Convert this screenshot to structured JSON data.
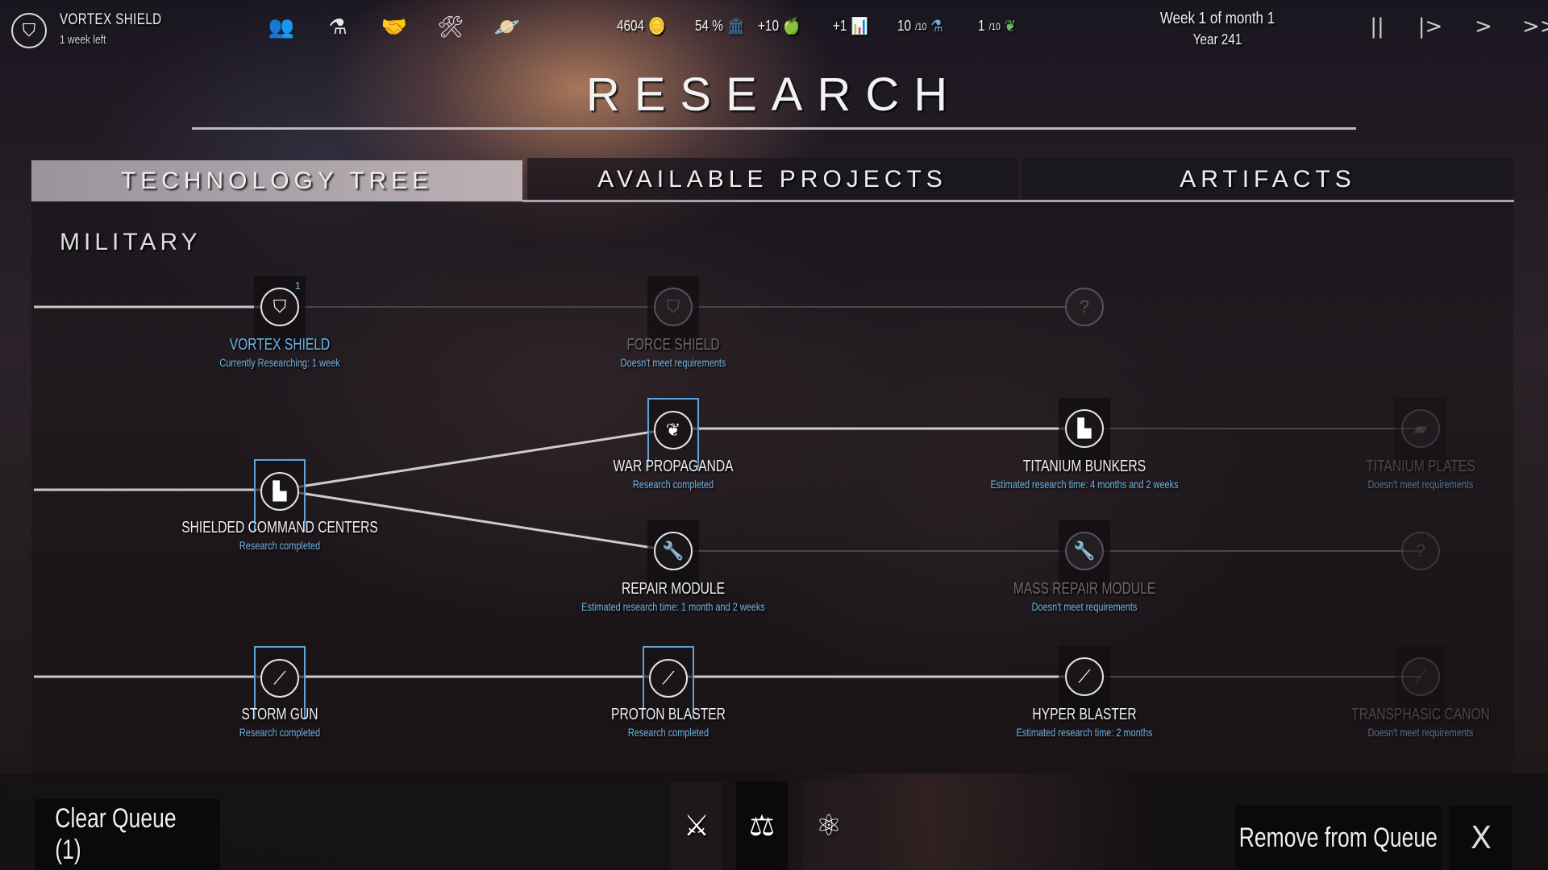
{
  "topbar": {
    "current_research": {
      "title": "VORTEX SHIELD",
      "subtitle": "1 week left",
      "icon": "shield-icon"
    },
    "nav_icons": [
      {
        "name": "population-icon",
        "glyph": "👥"
      },
      {
        "name": "research-flask-icon",
        "glyph": "⚗"
      },
      {
        "name": "diplomacy-handshake-icon",
        "glyph": "🤝"
      },
      {
        "name": "construction-tools-icon",
        "glyph": "🛠"
      },
      {
        "name": "planet-icon",
        "glyph": "🪐"
      }
    ],
    "resources": [
      {
        "name": "credits",
        "value": "4604",
        "icon": "coins-icon",
        "glyph": "🪙",
        "color": "#d9cf6a"
      },
      {
        "name": "approval",
        "value": "54 %",
        "icon": "government-building-icon",
        "glyph": "🏛",
        "color": "#4a86b8"
      },
      {
        "name": "food",
        "value": "+10",
        "icon": "apple-icon",
        "glyph": "🍏",
        "color": "#5e9a6a"
      },
      {
        "name": "industry",
        "value": "+1",
        "icon": "growth-chart-icon",
        "glyph": "📊",
        "color": "#9a66c4"
      },
      {
        "name": "research",
        "value": "10",
        "max": "/10",
        "icon": "flask-icon",
        "glyph": "⚗",
        "color": "#6aaee0"
      },
      {
        "name": "influence",
        "value": "1",
        "max": "/10",
        "icon": "laurel-icon",
        "glyph": "❦",
        "color": "#6bbf6b"
      }
    ],
    "date": {
      "line1": "Week 1 of month 1",
      "line2": "Year 241"
    },
    "speed_controls": [
      {
        "name": "pause-button",
        "glyph": "||"
      },
      {
        "name": "step-button",
        "glyph": "|>"
      },
      {
        "name": "play-button",
        "glyph": ">"
      },
      {
        "name": "fast-forward-button",
        "glyph": ">>"
      }
    ]
  },
  "title": "RESEARCH",
  "tabs": [
    {
      "label": "TECHNOLOGY TREE",
      "active": true
    },
    {
      "label": "AVAILABLE PROJECTS",
      "active": false
    },
    {
      "label": "ARTIFACTS",
      "active": false
    }
  ],
  "section": "MILITARY",
  "nodes": [
    {
      "id": "vortex",
      "name": "VORTEX SHIELD",
      "status": "Currently Researching: 1 week",
      "state": "active",
      "icon": "shield-icon",
      "glyph": "⛉",
      "badge": "1"
    },
    {
      "id": "force",
      "name": "FORCE SHIELD",
      "status": "Doesn't meet requirements",
      "state": "locked",
      "icon": "shield-icon",
      "glyph": "⛉"
    },
    {
      "id": "unknown1",
      "name": "",
      "status": "",
      "state": "unknown",
      "icon": "question-icon",
      "glyph": "?"
    },
    {
      "id": "war",
      "name": "WAR PROPAGANDA",
      "status": "Research completed",
      "state": "completed",
      "icon": "laurel-icon",
      "glyph": "❦"
    },
    {
      "id": "bunkers",
      "name": "TITANIUM BUNKERS",
      "status": "Estimated research time: 4 months and 2 weeks",
      "state": "available",
      "icon": "buildings-icon",
      "glyph": "▙"
    },
    {
      "id": "plates",
      "name": "TITANIUM PLATES",
      "status": "Doesn't meet requirements",
      "state": "locked-dim",
      "icon": "armor-plates-icon",
      "glyph": "▰"
    },
    {
      "id": "shielded",
      "name": "SHIELDED COMMAND CENTERS",
      "status": "Research completed",
      "state": "completed",
      "icon": "buildings-icon",
      "glyph": "▙"
    },
    {
      "id": "repair",
      "name": "REPAIR MODULE",
      "status": "Estimated research time: 1 month and 2 weeks",
      "state": "available",
      "icon": "wrench-icon",
      "glyph": "🔧"
    },
    {
      "id": "massrepair",
      "name": "MASS REPAIR MODULE",
      "status": "Doesn't meet requirements",
      "state": "locked",
      "icon": "wrench-icon",
      "glyph": "🔧"
    },
    {
      "id": "unknown2",
      "name": "",
      "status": "",
      "state": "unknown-dim",
      "icon": "question-icon",
      "glyph": "?"
    },
    {
      "id": "storm",
      "name": "STORM GUN",
      "status": "Research completed",
      "state": "completed",
      "icon": "blaster-icon",
      "glyph": "⟋"
    },
    {
      "id": "proton",
      "name": "PROTON BLASTER",
      "status": "Research completed",
      "state": "completed",
      "icon": "blaster-icon",
      "glyph": "⟋"
    },
    {
      "id": "hyper",
      "name": "HYPER BLASTER",
      "status": "Estimated research time: 2 months",
      "state": "available",
      "icon": "blaster-icon",
      "glyph": "⟋"
    },
    {
      "id": "transphasic",
      "name": "TRANSPHASIC CANON",
      "status": "Doesn't meet requirements",
      "state": "locked-dim",
      "icon": "blaster-icon",
      "glyph": "⟋"
    }
  ],
  "links": [
    [
      "vortex",
      "force"
    ],
    [
      "force",
      "unknown1"
    ],
    [
      "shielded",
      "war"
    ],
    [
      "shielded",
      "repair"
    ],
    [
      "war",
      "bunkers"
    ],
    [
      "bunkers",
      "plates"
    ],
    [
      "repair",
      "massrepair"
    ],
    [
      "massrepair",
      "unknown2"
    ],
    [
      "storm",
      "proton"
    ],
    [
      "proton",
      "hyper"
    ],
    [
      "hyper",
      "transphasic"
    ]
  ],
  "bottom": {
    "clear_queue": "Clear Queue (1)",
    "categories": [
      {
        "name": "military-category-crossed-swords-icon",
        "glyph": "⚔"
      },
      {
        "name": "society-category-scales-icon",
        "glyph": "⚖"
      },
      {
        "name": "science-category-atom-icon",
        "glyph": "⚛"
      }
    ],
    "remove_from_queue": "Remove from Queue",
    "close_glyph": "X"
  }
}
